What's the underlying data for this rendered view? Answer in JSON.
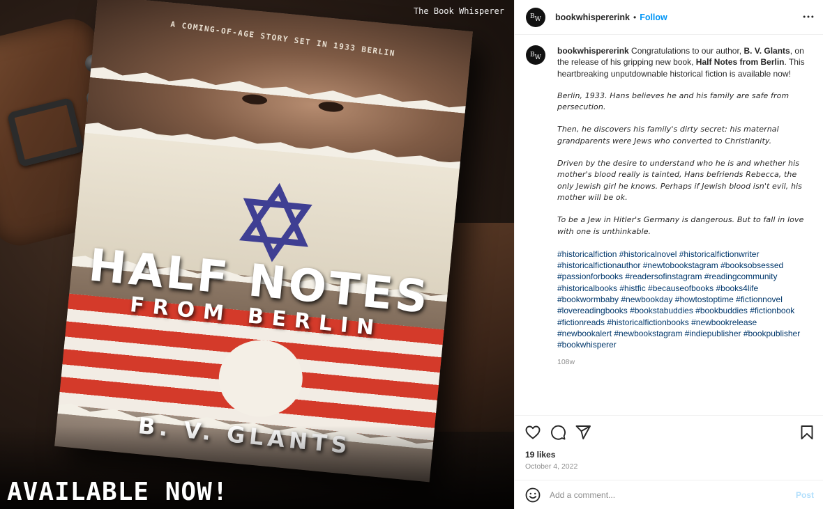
{
  "media": {
    "watermark": "The Book Whisperer",
    "overlay_text": "AVAILABLE NOW!",
    "book": {
      "tagline": "A COMING-OF-AGE STORY SET IN 1933 BERLIN",
      "title": "HALF NOTES",
      "subtitle": "FROM BERLIN",
      "author": "B. V. GLANTS"
    }
  },
  "header": {
    "avatar_text_top": "B",
    "avatar_text_bottom": "W",
    "username": "bookwhispererink",
    "dot": "•",
    "follow_label": "Follow",
    "more_icon": "more-horizontal-icon"
  },
  "caption": {
    "username": "bookwhispererink",
    "intro_1": " Congratulations to our author, ",
    "author_bold": "B. V. Glants",
    "intro_2": ", on the release of his gripping new book, ",
    "book_bold": "Half Notes from Berlin",
    "intro_3": ". This heartbreaking unputdownable historical fiction is available now!",
    "paragraphs": [
      "Berlin, 1933. Hans believes he and his family are safe from persecution.",
      "Then, he discovers his family's dirty secret: his maternal grandparents were Jews who converted to Christianity.",
      "Driven by the desire to understand who he is and whether his mother's blood really is tainted, Hans befriends Rebecca, the only Jewish girl he knows. Perhaps if Jewish blood isn't evil, his mother will be ok.",
      "To be a Jew in Hitler's Germany is dangerous. But to fall in love with one is unthinkable."
    ],
    "hashtags": "#historicalfiction #historicalnovel #historicalfictionwriter #historicalfictionauthor #newtobookstagram #booksobsessed #passionforbooks #readersofinstagram #readingcommunity #historicalbooks #histfic #becauseofbooks #books4life #bookwormbaby #newbookday #howtostoptime #fictionnovel #lovereadingbooks #bookstabuddies #bookbuddies #fictionbook #fictionreads #historicalfictionbooks #newbookrelease #newbookalert #newbookstagram #indiepublisher #bookpublisher #bookwhisperer",
    "age": "108w"
  },
  "actions": {
    "icons": [
      "heart-icon",
      "comment-icon",
      "share-icon",
      "bookmark-icon"
    ],
    "likes": "19 likes",
    "date": "October 4, 2022"
  },
  "comment": {
    "placeholder": "Add a comment...",
    "post_label": "Post",
    "emoji_icon": "emoji-icon"
  },
  "colors": {
    "accent": "#0095f6",
    "hashtag": "#00376b",
    "muted": "#8e8e8e",
    "post_disabled": "#b2dffc"
  }
}
